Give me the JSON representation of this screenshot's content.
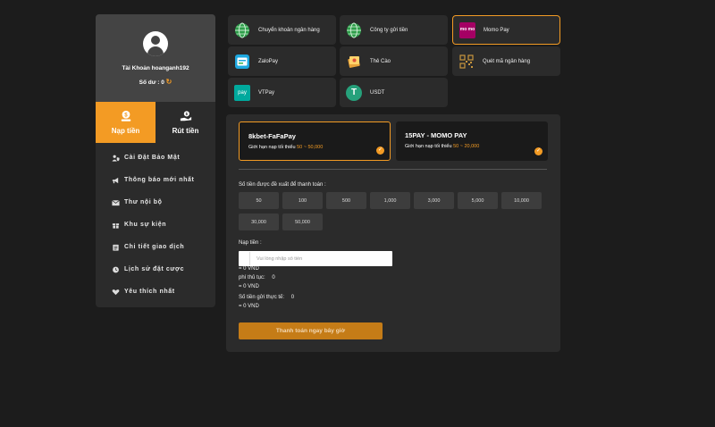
{
  "profile": {
    "account_label": "Tài Khoản hoanganh192",
    "balance_label": "Số dư : 0"
  },
  "tabs": [
    {
      "label": "Nạp tiền",
      "active": true
    },
    {
      "label": "Rút tiền",
      "active": false
    }
  ],
  "menu": [
    {
      "label": "Cài Đặt Bảo Mật",
      "icon": "user-shield-icon"
    },
    {
      "label": "Thông báo mới nhất",
      "icon": "megaphone-icon"
    },
    {
      "label": "Thư nội bộ",
      "icon": "envelope-icon"
    },
    {
      "label": "Khu sự kiện",
      "icon": "gift-icon"
    },
    {
      "label": "Chi tiết giao dịch",
      "icon": "clipboard-icon"
    },
    {
      "label": "Lịch sử đặt cược",
      "icon": "clock-icon"
    },
    {
      "label": "Yêu thích nhất",
      "icon": "heart-icon"
    }
  ],
  "payment_methods": [
    {
      "label": "Chuyển khoản ngân hàng",
      "icon": "globe-icon"
    },
    {
      "label": "Công ty gửi tiền",
      "icon": "globe-icon"
    },
    {
      "label": "Momo Pay",
      "icon": "momo-logo-icon",
      "logo_text": "mo mo",
      "selected": true
    },
    {
      "label": "ZaloPay",
      "icon": "zalopay-icon"
    },
    {
      "label": "Thẻ Cào",
      "icon": "scratch-card-icon"
    },
    {
      "label": "Quét mã ngân hàng",
      "icon": "qr-code-icon"
    },
    {
      "label": "VTPay",
      "icon": "vtpay-icon",
      "logo_text": "pay"
    },
    {
      "label": "USDT",
      "icon": "tether-icon",
      "logo_text": "T"
    }
  ],
  "gateways": [
    {
      "name": "8kbet-FaFaPay",
      "limit_prefix": "Giới hạn nạp tối thiểu",
      "range": "50 ~ 50,000",
      "selected": true
    },
    {
      "name": "15PAY - MOMO PAY",
      "limit_prefix": "Giới hạn nạp tối thiểu",
      "range": "50 ~ 20,000",
      "selected": false
    }
  ],
  "suggest_label": "Số tiền được đề xuất để thanh toán :",
  "amounts": [
    "50",
    "100",
    "500",
    "1,000",
    "3,000",
    "5,000",
    "10,000",
    "30,000",
    "50,000"
  ],
  "deposit": {
    "label": "Nạp tiền :",
    "placeholder": "Vui lòng nhập số tiền",
    "converted": "= 0 VND",
    "fee_label": "phí thủ tục:",
    "fee_value": "0",
    "fee_converted": "= 0 VND",
    "actual_label": "Số tiền gửi thực tế:",
    "actual_value": "0",
    "actual_converted": "= 0 VND",
    "submit_label": "Thanh toán ngay bây giờ"
  },
  "colors": {
    "accent": "#f39b24",
    "panel": "#2b2b2b",
    "background": "#1c1c1c"
  }
}
